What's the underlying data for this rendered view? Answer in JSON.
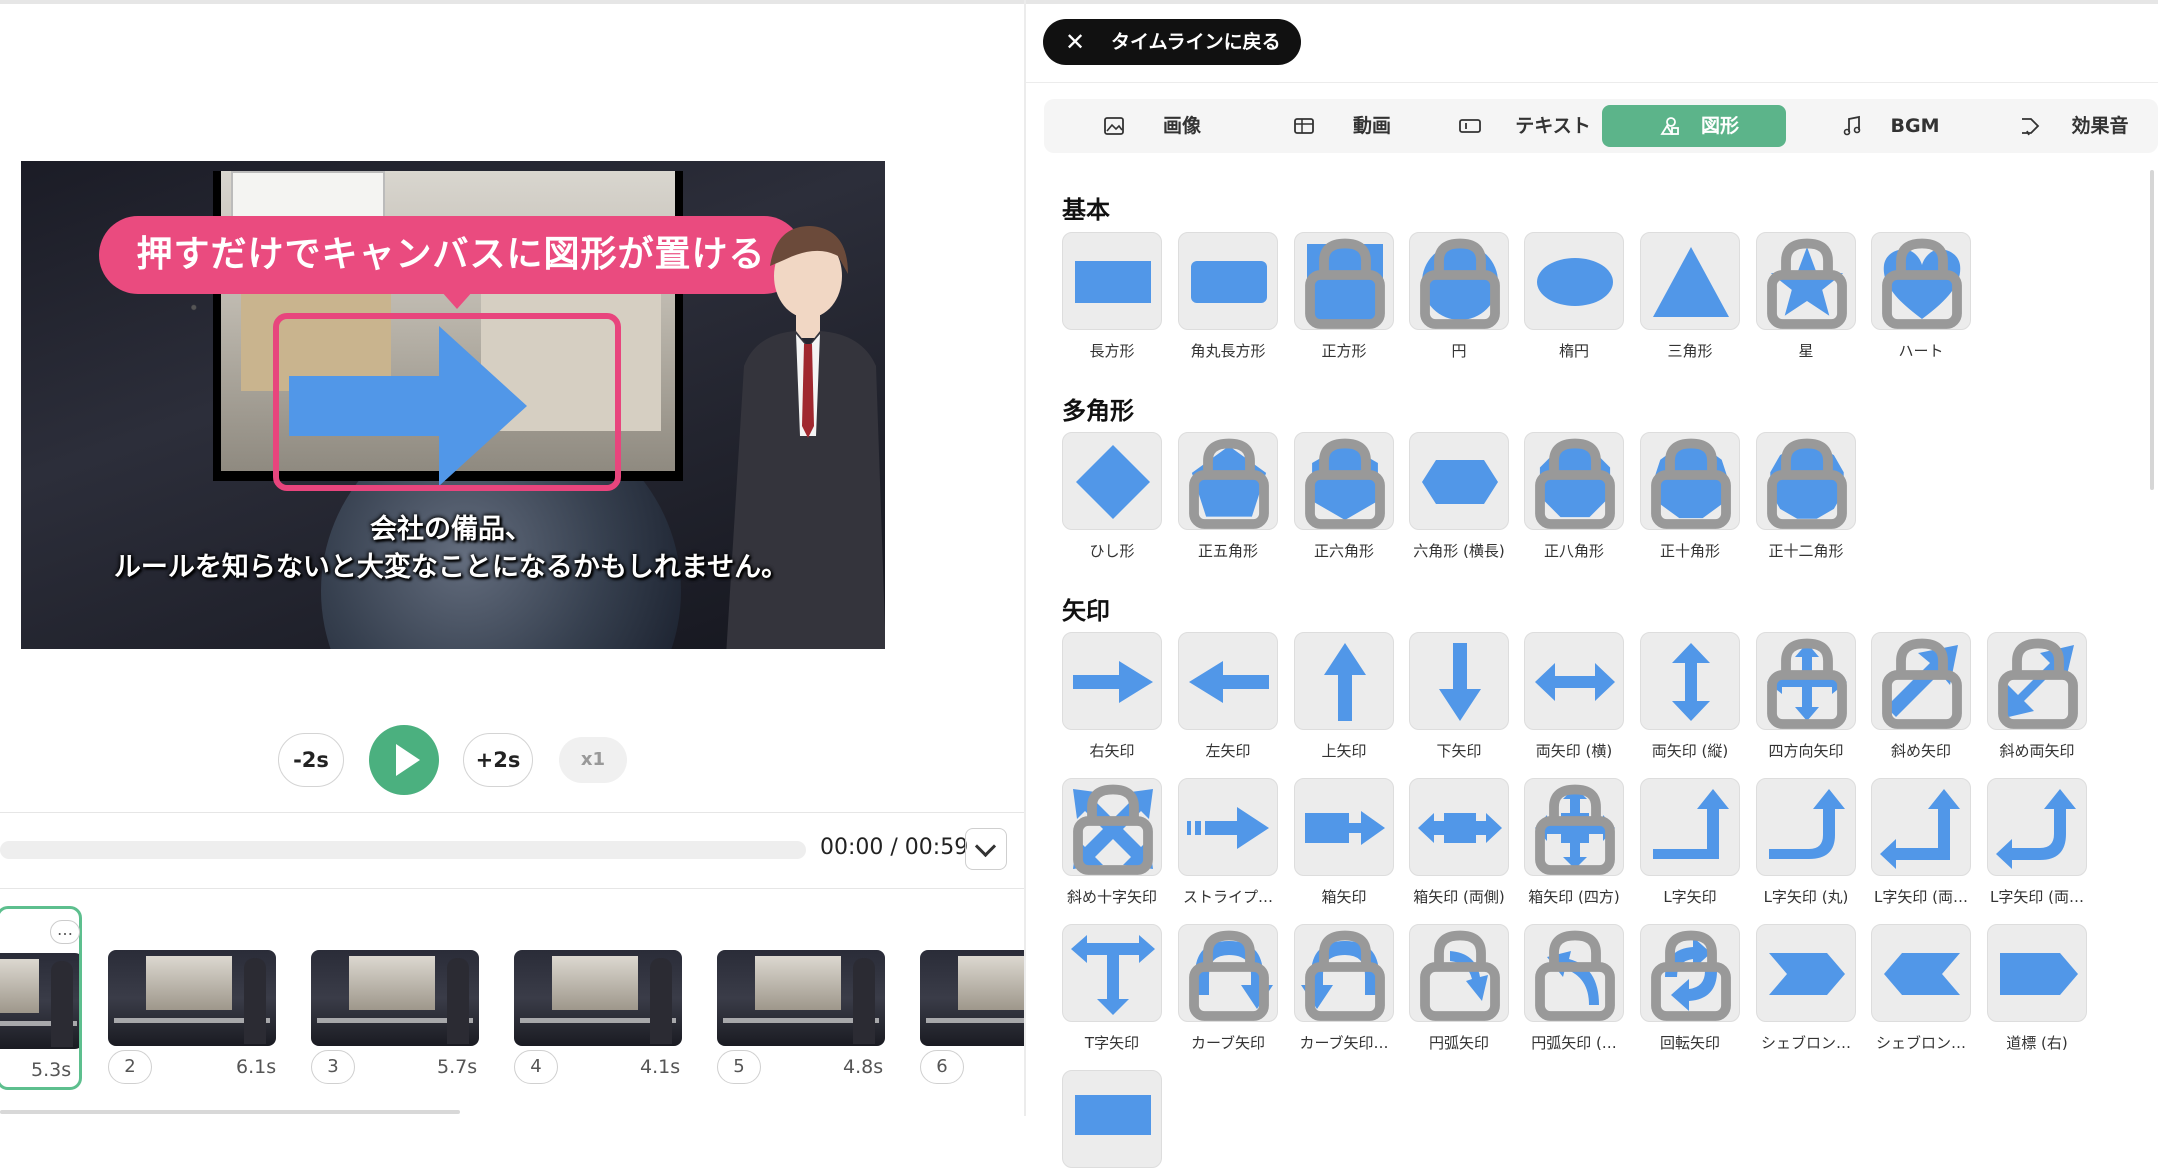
{
  "preview": {
    "callout_text": "押すだけでキャンバスに図形が置ける",
    "subtitle_line1": "会社の備品、",
    "subtitle_line2": "ルールを知らないと大変なことになるかもしれません。"
  },
  "player": {
    "back2_label": "-2s",
    "forward2_label": "+2s",
    "speed_label": "x1",
    "time_display": "00:00 / 00:59",
    "progress": 0
  },
  "scenes": [
    {
      "number": "",
      "duration": "5.3s",
      "selected": true
    },
    {
      "number": "2",
      "duration": "6.1s"
    },
    {
      "number": "3",
      "duration": "5.7s"
    },
    {
      "number": "4",
      "duration": "4.1s"
    },
    {
      "number": "5",
      "duration": "4.8s"
    },
    {
      "number": "6",
      "duration": ""
    }
  ],
  "scene_more_label": "…",
  "panel": {
    "back_button_label": "タイムラインに戻る",
    "tabs": [
      {
        "label": "画像",
        "icon": "image-icon"
      },
      {
        "label": "動画",
        "icon": "film-icon"
      },
      {
        "label": "テキスト",
        "icon": "text-icon"
      },
      {
        "label": "図形",
        "icon": "shapes-icon",
        "active": true
      },
      {
        "label": "BGM",
        "icon": "music-icon"
      },
      {
        "label": "効果音",
        "icon": "sound-effect-icon"
      }
    ],
    "sections": {
      "basic": "基本",
      "polygon": "多角形",
      "arrow": "矢印"
    },
    "shape_color": "#5197e8",
    "accent_color": "#5cb48a"
  },
  "shapes": {
    "basic": [
      {
        "label": "長方形",
        "icon": "rectangle-icon",
        "locked": false
      },
      {
        "label": "角丸長方形",
        "icon": "rounded-rectangle-icon",
        "locked": false
      },
      {
        "label": "正方形",
        "icon": "square-icon",
        "locked": true
      },
      {
        "label": "円",
        "icon": "circle-icon",
        "locked": true
      },
      {
        "label": "楕円",
        "icon": "ellipse-icon",
        "locked": false
      },
      {
        "label": "三角形",
        "icon": "triangle-icon",
        "locked": false
      },
      {
        "label": "星",
        "icon": "star-icon",
        "locked": true
      },
      {
        "label": "ハート",
        "icon": "heart-icon",
        "locked": true
      }
    ],
    "polygon": [
      {
        "label": "ひし形",
        "icon": "diamond-icon",
        "locked": false
      },
      {
        "label": "正五角形",
        "icon": "pentagon-icon",
        "locked": true
      },
      {
        "label": "正六角形",
        "icon": "hexagon-icon",
        "locked": true
      },
      {
        "label": "六角形 (横長)",
        "icon": "wide-hexagon-icon",
        "locked": false
      },
      {
        "label": "正八角形",
        "icon": "octagon-icon",
        "locked": true
      },
      {
        "label": "正十角形",
        "icon": "decagon-icon",
        "locked": true
      },
      {
        "label": "正十二角形",
        "icon": "dodecagon-icon",
        "locked": true
      }
    ],
    "arrow": [
      {
        "label": "右矢印",
        "icon": "right-arrow-icon",
        "locked": false
      },
      {
        "label": "左矢印",
        "icon": "left-arrow-icon",
        "locked": false
      },
      {
        "label": "上矢印",
        "icon": "up-arrow-icon",
        "locked": false
      },
      {
        "label": "下矢印",
        "icon": "down-arrow-icon",
        "locked": false
      },
      {
        "label": "両矢印 (横)",
        "icon": "horizontal-double-arrow-icon",
        "locked": false
      },
      {
        "label": "両矢印 (縦)",
        "icon": "vertical-double-arrow-icon",
        "locked": false
      },
      {
        "label": "四方向矢印",
        "icon": "four-way-arrow-icon",
        "locked": true
      },
      {
        "label": "斜め矢印",
        "icon": "diagonal-arrow-icon",
        "locked": true
      },
      {
        "label": "斜め両矢印",
        "icon": "diagonal-double-arrow-icon",
        "locked": true
      },
      {
        "label": "斜め十字矢印",
        "icon": "diagonal-cross-arrow-icon",
        "locked": true
      },
      {
        "label": "ストライプ…",
        "icon": "striped-arrow-icon",
        "locked": false
      },
      {
        "label": "箱矢印",
        "icon": "box-arrow-icon",
        "locked": false
      },
      {
        "label": "箱矢印 (両側)",
        "icon": "box-double-arrow-icon",
        "locked": false
      },
      {
        "label": "箱矢印 (四方)",
        "icon": "box-four-way-arrow-icon",
        "locked": true
      },
      {
        "label": "L字矢印",
        "icon": "l-arrow-icon",
        "locked": false
      },
      {
        "label": "L字矢印 (丸)",
        "icon": "l-round-arrow-icon",
        "locked": false
      },
      {
        "label": "L字矢印 (両…",
        "icon": "l-double-arrow-icon",
        "locked": false
      },
      {
        "label": "L字矢印 (両…",
        "icon": "l-double-round-arrow-icon",
        "locked": false
      },
      {
        "label": "T字矢印",
        "icon": "t-arrow-icon",
        "locked": false
      },
      {
        "label": "カーブ矢印",
        "icon": "curved-arrow-icon",
        "locked": true
      },
      {
        "label": "カーブ矢印…",
        "icon": "curved-arrow-alt-icon",
        "locked": true
      },
      {
        "label": "円弧矢印",
        "icon": "arc-arrow-icon",
        "locked": true
      },
      {
        "label": "円弧矢印 (…",
        "icon": "arc-arrow-alt-icon",
        "locked": true
      },
      {
        "label": "回転矢印",
        "icon": "rotate-arrow-icon",
        "locked": true
      },
      {
        "label": "シェブロン…",
        "icon": "chevron-right-shape-icon",
        "locked": false
      },
      {
        "label": "シェブロン…",
        "icon": "chevron-left-shape-icon",
        "locked": false
      },
      {
        "label": "道標 (右)",
        "icon": "signpost-right-icon",
        "locked": false
      },
      {
        "label": "",
        "icon": "partial-shape-icon",
        "locked": false
      }
    ]
  }
}
